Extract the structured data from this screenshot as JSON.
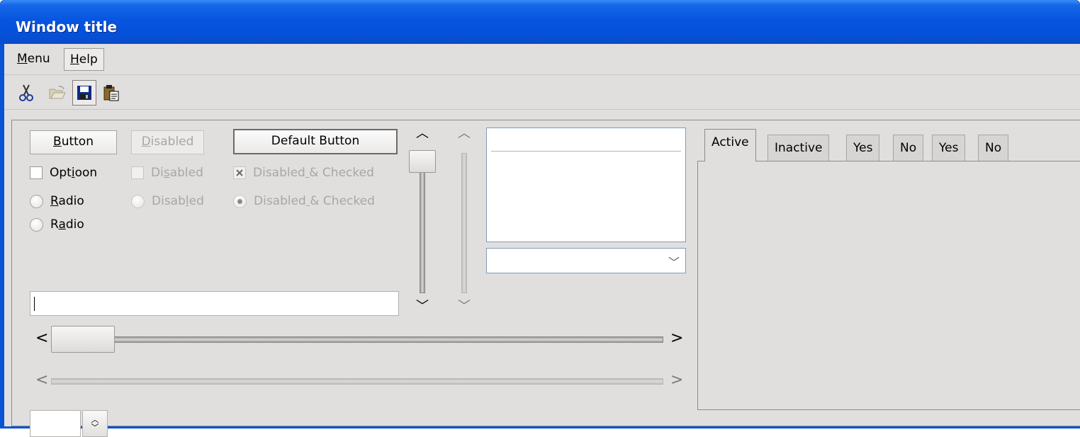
{
  "window": {
    "title": "Window title"
  },
  "menubar": {
    "items": [
      {
        "label": "Menu",
        "mnemonic": "M",
        "rest": "enu"
      },
      {
        "label": "Help",
        "mnemonic": "H",
        "rest": "elp"
      }
    ]
  },
  "toolbar": {
    "buttons": [
      {
        "icon": "cut-icon"
      },
      {
        "icon": "open-folder-icon"
      },
      {
        "icon": "save-icon"
      },
      {
        "icon": "paste-icon"
      }
    ]
  },
  "buttons": {
    "button": {
      "mn": "B",
      "rest": "utton"
    },
    "disabled": {
      "mn": "D",
      "rest": "isabled"
    },
    "default": "Default Button"
  },
  "checkboxes": {
    "option": {
      "pre": "Opt",
      "mn": "i",
      "post": "oon"
    },
    "disabled": {
      "pre": "Di",
      "mn": "s",
      "post": "abled"
    },
    "disabled_checked": {
      "pre": "Disabled",
      "mn": " ",
      "post": "& Checked"
    }
  },
  "radios": {
    "radio1": {
      "mn": "R",
      "rest": "adio"
    },
    "disabled": {
      "pre": "Disab",
      "mn": "l",
      "post": "ed"
    },
    "disabled_checked": {
      "pre": "Disabled",
      "mn": " ",
      "post": "& Checked"
    },
    "radio2": {
      "pre": "R",
      "mn": "a",
      "post": "dio"
    }
  },
  "tabs": [
    "Active",
    "Inactive",
    "Yes",
    "No",
    "Yes",
    "No"
  ],
  "colors": {
    "titlebar": "#0650d8",
    "client": "#e1dfde",
    "list_border": "#7f9db9"
  }
}
